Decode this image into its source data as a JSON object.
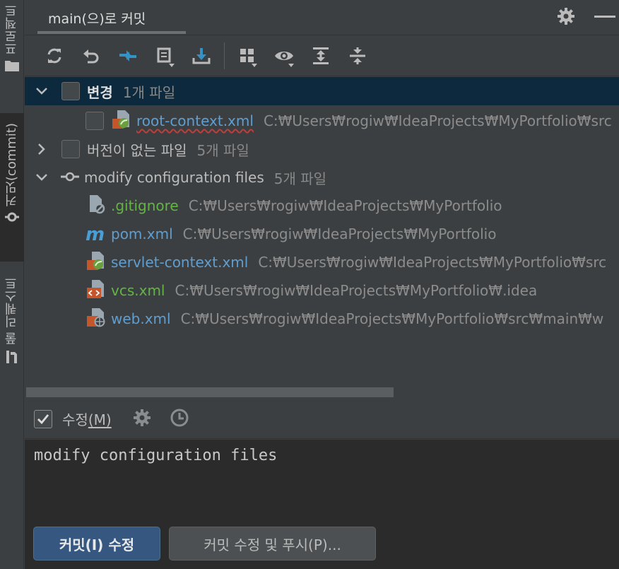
{
  "sidebar": {
    "project_label": "프로젝트",
    "commit_label": "커밋(commit)",
    "pull_requests_label": "풀 리퀘스트"
  },
  "tab": {
    "title": "main(으)로 커밋"
  },
  "toolbar": {
    "icons": [
      "refresh-icon",
      "rollback-icon",
      "diff-icon",
      "shelve-icon",
      "update-icon",
      "group-by-icon",
      "view-options-icon",
      "expand-all-icon",
      "collapse-all-icon"
    ]
  },
  "tree": {
    "changes": {
      "label": "변경",
      "count": "1개 파일",
      "files": [
        {
          "name": "root-context.xml",
          "path": "C:₩Users₩rogiw₩IdeaProjects₩MyPortfolio₩src"
        }
      ]
    },
    "unversioned": {
      "label": "버전이 없는 파일",
      "count": "5개 파일"
    },
    "commit": {
      "label": "modify configuration files",
      "count": "5개 파일",
      "files": [
        {
          "name": ".gitignore",
          "path": "C:₩Users₩rogiw₩IdeaProjects₩MyPortfolio",
          "color": "#62b543"
        },
        {
          "name": "pom.xml",
          "path": "C:₩Users₩rogiw₩IdeaProjects₩MyPortfolio",
          "color": "#5f9ed0"
        },
        {
          "name": "servlet-context.xml",
          "path": "C:₩Users₩rogiw₩IdeaProjects₩MyPortfolio₩src",
          "color": "#5f9ed0"
        },
        {
          "name": "vcs.xml",
          "path": "C:₩Users₩rogiw₩IdeaProjects₩MyPortfolio₩.idea",
          "color": "#62b543"
        },
        {
          "name": "web.xml",
          "path": "C:₩Users₩rogiw₩IdeaProjects₩MyPortfolio₩src₩main₩w",
          "color": "#5f9ed0"
        }
      ]
    }
  },
  "amend": {
    "label": "수정",
    "mnemonic": "(M)",
    "checked": true
  },
  "message": "modify configuration files",
  "buttons": {
    "commit": "커밋(I) 수정",
    "commit_push": "커밋 수정 및 푸시(P)..."
  },
  "colors": {
    "accent": "#365880",
    "selection": "#0d293e",
    "bg": "#3c3f41",
    "editor_bg": "#2b2b2b"
  }
}
